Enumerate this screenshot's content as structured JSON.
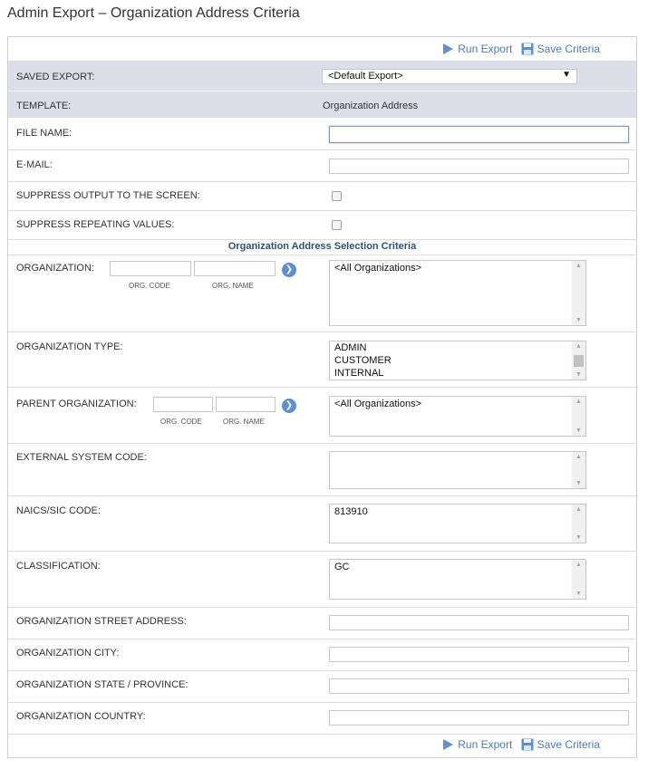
{
  "page": {
    "title": "Admin Export – Organization Address Criteria"
  },
  "actions": {
    "run_export": "Run Export",
    "save_criteria": "Save Criteria"
  },
  "saved_export": {
    "label": "SAVED EXPORT:",
    "value": "<Default Export>"
  },
  "template": {
    "label": "TEMPLATE:",
    "value": "Organization Address"
  },
  "file_name": {
    "label": "FILE NAME:",
    "value": ""
  },
  "email": {
    "label": "E-MAIL:",
    "value": ""
  },
  "suppress_output": {
    "label": "SUPPRESS OUTPUT TO THE SCREEN:",
    "checked": false
  },
  "suppress_repeating": {
    "label": "SUPPRESS REPEATING VALUES:",
    "checked": false
  },
  "section": {
    "heading": "Organization Address Selection Criteria"
  },
  "organization": {
    "label": "ORGANIZATION:",
    "code_caption": "ORG. CODE",
    "name_caption": "ORG. NAME",
    "list": [
      "<All Organizations>"
    ]
  },
  "organization_type": {
    "label": "ORGANIZATION TYPE:",
    "list": [
      "ADMIN",
      "CUSTOMER",
      "INTERNAL"
    ]
  },
  "parent_organization": {
    "label": "PARENT ORGANIZATION:",
    "code_caption": "ORG. CODE",
    "name_caption": "ORG. NAME",
    "list": [
      "<All Organizations>"
    ]
  },
  "external_system_code": {
    "label": "EXTERNAL SYSTEM CODE:",
    "list": []
  },
  "naics_sic_code": {
    "label": "NAICS/SIC CODE:",
    "list": [
      "813910"
    ]
  },
  "classification": {
    "label": "CLASSIFICATION:",
    "list": [
      "GC"
    ]
  },
  "street_address": {
    "label": "ORGANIZATION STREET ADDRESS:",
    "value": ""
  },
  "city": {
    "label": "ORGANIZATION CITY:",
    "value": ""
  },
  "state": {
    "label": "ORGANIZATION STATE / PROVINCE:",
    "value": ""
  },
  "country": {
    "label": "ORGANIZATION COUNTRY:",
    "value": ""
  },
  "colors": {
    "accent": "#4a7ab5",
    "header_band": "#dcdfe9",
    "go_button": "#5f8fd1"
  },
  "icons": {
    "run": "play-icon",
    "save": "floppy-disk-icon",
    "go": "chevron-right-icon"
  }
}
